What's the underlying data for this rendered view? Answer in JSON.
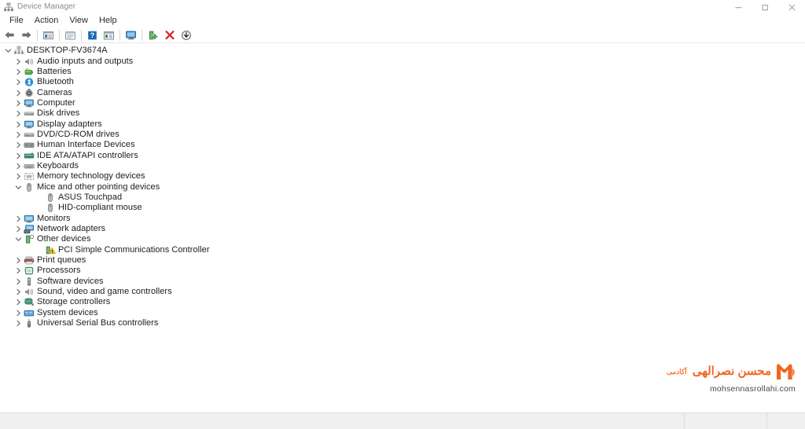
{
  "window": {
    "title": "Device Manager",
    "title_icon": "device-manager-icon",
    "caption": {
      "minimize": "minimize-icon",
      "maximize": "restore-icon",
      "close": "close-icon"
    }
  },
  "menubar": {
    "items": [
      {
        "label": "File",
        "name": "menu-file"
      },
      {
        "label": "Action",
        "name": "menu-action"
      },
      {
        "label": "View",
        "name": "menu-view"
      },
      {
        "label": "Help",
        "name": "menu-help"
      }
    ]
  },
  "toolbar": {
    "buttons": [
      {
        "name": "back-button",
        "icon": "arrow-left-icon",
        "tooltip": "Back"
      },
      {
        "name": "forward-button",
        "icon": "arrow-right-icon",
        "tooltip": "Forward"
      },
      {
        "name": "separator-1",
        "icon": "separator",
        "tooltip": ""
      },
      {
        "name": "show-hide-console-tree-button",
        "icon": "console-tree-icon",
        "tooltip": "Show/Hide Console Tree"
      },
      {
        "name": "separator-2",
        "icon": "separator",
        "tooltip": ""
      },
      {
        "name": "properties-button",
        "icon": "properties-icon",
        "tooltip": "Properties"
      },
      {
        "name": "separator-3",
        "icon": "separator",
        "tooltip": ""
      },
      {
        "name": "help-button",
        "icon": "help-question-icon",
        "tooltip": "Help"
      },
      {
        "name": "scan-for-hardware-changes-button",
        "icon": "scan-hardware-icon",
        "tooltip": "Scan for hardware changes"
      },
      {
        "name": "separator-4",
        "icon": "separator",
        "tooltip": ""
      },
      {
        "name": "show-devices-button",
        "icon": "monitor-blue-icon",
        "tooltip": "Show devices"
      },
      {
        "name": "separator-5",
        "icon": "separator",
        "tooltip": ""
      },
      {
        "name": "update-driver-button",
        "icon": "update-driver-icon",
        "tooltip": "Update driver"
      },
      {
        "name": "uninstall-device-button",
        "icon": "red-x-icon",
        "tooltip": "Uninstall device"
      },
      {
        "name": "disable-device-button",
        "icon": "disable-device-icon",
        "tooltip": "Disable device"
      }
    ]
  },
  "tree": {
    "nodes": [
      {
        "label": "DESKTOP-FV3674A",
        "level": 0,
        "state": "expanded",
        "icon": "computer-root-icon",
        "name": "tree-node-desktop-fv3674a"
      },
      {
        "label": "Audio inputs and outputs",
        "level": 1,
        "state": "collapsed",
        "icon": "speaker-icon",
        "name": "tree-node-audio-inputs-and-outputs"
      },
      {
        "label": "Batteries",
        "level": 1,
        "state": "collapsed",
        "icon": "battery-icon",
        "name": "tree-node-batteries"
      },
      {
        "label": "Bluetooth",
        "level": 1,
        "state": "collapsed",
        "icon": "bluetooth-icon",
        "name": "tree-node-bluetooth"
      },
      {
        "label": "Cameras",
        "level": 1,
        "state": "collapsed",
        "icon": "camera-icon",
        "name": "tree-node-cameras"
      },
      {
        "label": "Computer",
        "level": 1,
        "state": "collapsed",
        "icon": "computer-icon",
        "name": "tree-node-computer"
      },
      {
        "label": "Disk drives",
        "level": 1,
        "state": "collapsed",
        "icon": "disk-drive-icon",
        "name": "tree-node-disk-drives"
      },
      {
        "label": "Display adapters",
        "level": 1,
        "state": "collapsed",
        "icon": "display-adapter-icon",
        "name": "tree-node-display-adapters"
      },
      {
        "label": "DVD/CD-ROM drives",
        "level": 1,
        "state": "collapsed",
        "icon": "dvd-drive-icon",
        "name": "tree-node-dvd-cd-rom-drives"
      },
      {
        "label": "Human Interface Devices",
        "level": 1,
        "state": "collapsed",
        "icon": "hid-icon",
        "name": "tree-node-human-interface-devices"
      },
      {
        "label": "IDE ATA/ATAPI controllers",
        "level": 1,
        "state": "collapsed",
        "icon": "ide-controller-icon",
        "name": "tree-node-ide-ata-atapi-controllers"
      },
      {
        "label": "Keyboards",
        "level": 1,
        "state": "collapsed",
        "icon": "keyboard-icon",
        "name": "tree-node-keyboards"
      },
      {
        "label": "Memory technology devices",
        "level": 1,
        "state": "collapsed",
        "icon": "memory-icon",
        "name": "tree-node-memory-technology-devices"
      },
      {
        "label": "Mice and other pointing devices",
        "level": 1,
        "state": "expanded",
        "icon": "mouse-icon",
        "name": "tree-node-mice-and-other-pointing-devices"
      },
      {
        "label": "ASUS Touchpad",
        "level": 2,
        "state": "leaf",
        "icon": "mouse-icon",
        "name": "tree-node-asus-touchpad"
      },
      {
        "label": "HID-compliant mouse",
        "level": 2,
        "state": "leaf",
        "icon": "mouse-icon",
        "name": "tree-node-hid-compliant-mouse"
      },
      {
        "label": "Monitors",
        "level": 1,
        "state": "collapsed",
        "icon": "monitor-icon",
        "name": "tree-node-monitors"
      },
      {
        "label": "Network adapters",
        "level": 1,
        "state": "collapsed",
        "icon": "network-adapter-icon",
        "name": "tree-node-network-adapters"
      },
      {
        "label": "Other devices",
        "level": 1,
        "state": "expanded",
        "icon": "other-devices-icon",
        "name": "tree-node-other-devices"
      },
      {
        "label": "PCI Simple Communications Controller",
        "level": 2,
        "state": "leaf",
        "icon": "unknown-device-warning-icon",
        "name": "tree-node-pci-simple-communications-controller"
      },
      {
        "label": "Print queues",
        "level": 1,
        "state": "collapsed",
        "icon": "printer-icon",
        "name": "tree-node-print-queues"
      },
      {
        "label": "Processors",
        "level": 1,
        "state": "collapsed",
        "icon": "processor-icon",
        "name": "tree-node-processors"
      },
      {
        "label": "Software devices",
        "level": 1,
        "state": "collapsed",
        "icon": "software-device-icon",
        "name": "tree-node-software-devices"
      },
      {
        "label": "Sound, video and game controllers",
        "level": 1,
        "state": "collapsed",
        "icon": "speaker-icon",
        "name": "tree-node-sound-video-and-game-controllers"
      },
      {
        "label": "Storage controllers",
        "level": 1,
        "state": "collapsed",
        "icon": "storage-controller-icon",
        "name": "tree-node-storage-controllers"
      },
      {
        "label": "System devices",
        "level": 1,
        "state": "collapsed",
        "icon": "system-device-icon",
        "name": "tree-node-system-devices"
      },
      {
        "label": "Universal Serial Bus controllers",
        "level": 1,
        "state": "collapsed",
        "icon": "usb-icon",
        "name": "tree-node-universal-serial-bus-controllers"
      }
    ]
  },
  "watermark": {
    "brand_small": "آکادمی",
    "brand_main": "محسن نصرالهی",
    "url": "mohsennasrollahi.com",
    "logo": "m-logo-icon",
    "accent_color": "#f26522"
  },
  "statusbar": {
    "main": "",
    "pane2": "",
    "pane3": ""
  }
}
